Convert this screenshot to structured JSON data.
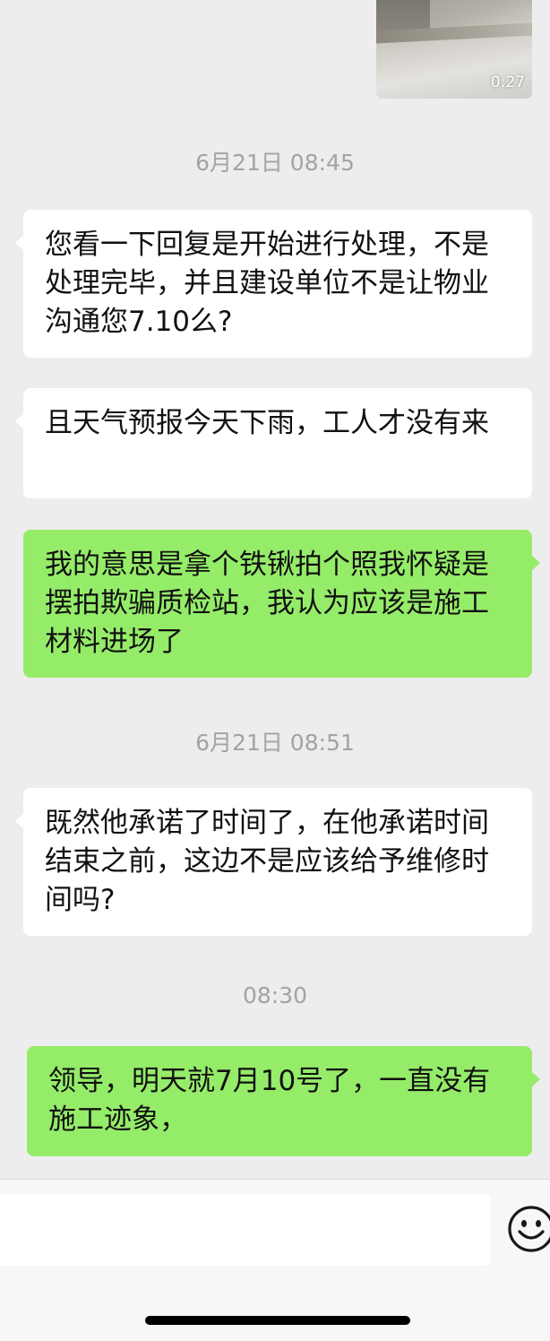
{
  "video_message": {
    "duration": "0:27"
  },
  "messages": [
    {
      "type": "timestamp",
      "text": "6月21日 08:45"
    },
    {
      "type": "received",
      "text": "您看一下回复是开始进行处理，不是处理完毕，并且建设单位不是让物业沟通您7.10么?"
    },
    {
      "type": "received",
      "text": "且天气预报今天下雨，工人才没有来"
    },
    {
      "type": "sent",
      "text": "我的意思是拿个铁锹拍个照我怀疑是摆拍欺骗质检站，我认为应该是施工材料进场了"
    },
    {
      "type": "timestamp",
      "text": "6月21日 08:51"
    },
    {
      "type": "received",
      "text": "既然他承诺了时间了，在他承诺时间结束之前，这边不是应该给予维修时间吗?"
    },
    {
      "type": "timestamp",
      "text": "08:30"
    },
    {
      "type": "sent",
      "text": "领导，明天就7月10号了，一直没有施工迹象，"
    }
  ],
  "input_bar": {
    "emoji_icon": "emoji-smile-icon"
  },
  "colors": {
    "background": "#ededed",
    "received_bubble": "#ffffff",
    "sent_bubble": "#95ec69",
    "timestamp_text": "#a3a3a3"
  }
}
